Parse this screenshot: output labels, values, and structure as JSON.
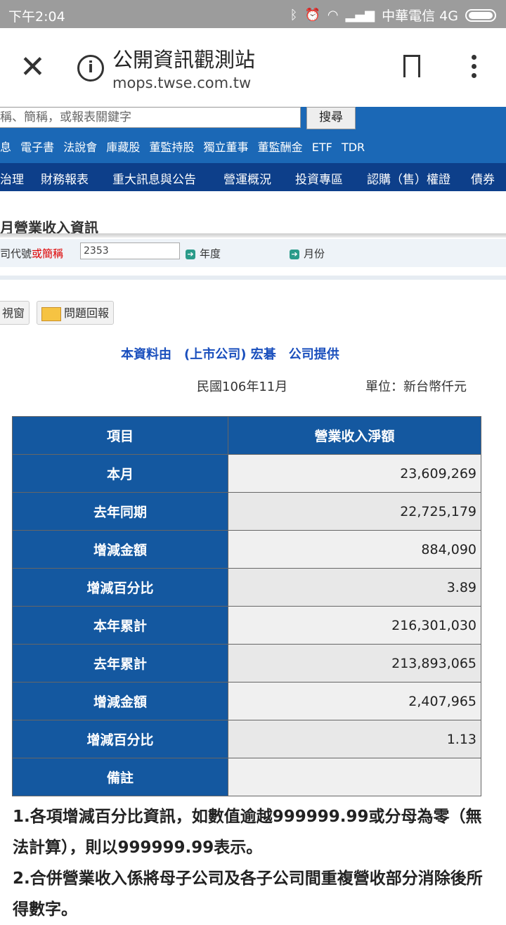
{
  "status_bar": {
    "time": "下午2:04",
    "carrier": "中華電信 4G"
  },
  "browser": {
    "page_title": "公開資訊觀測站",
    "url": "mops.twse.com.tw"
  },
  "search": {
    "placeholder": "稱、簡稱，或報表關鍵字",
    "button": "搜尋"
  },
  "quick_links": [
    "息",
    "電子書",
    "法說會",
    "庫藏股",
    "董監持股",
    "獨立董事",
    "董監酬金",
    "ETF",
    "TDR"
  ],
  "nav": [
    "治理",
    "財務報表",
    "重大訊息與公告",
    "營運概況",
    "投資專區",
    "認購（售）權證",
    "債券"
  ],
  "section": {
    "title": "月營業收入資訊",
    "code_label_prefix": "司代號",
    "code_label_red": "或簡稱",
    "code_value": "2353",
    "year_label": "年度",
    "month_label": "月份"
  },
  "toolbar": {
    "new_window": "視窗",
    "report": "問題回報"
  },
  "provider": {
    "text": "本資料由　(上市公司) 宏碁　公司提供"
  },
  "period": "民國106年11月",
  "unit": "單位：新台幣仟元",
  "table": {
    "headers": [
      "項目",
      "營業收入淨額"
    ],
    "rows": [
      {
        "item": "本月",
        "value": "23,609,269"
      },
      {
        "item": "去年同期",
        "value": "22,725,179"
      },
      {
        "item": "增減金額",
        "value": "884,090"
      },
      {
        "item": "增減百分比",
        "value": "3.89"
      },
      {
        "item": "本年累計",
        "value": "216,301,030"
      },
      {
        "item": "去年累計",
        "value": "213,893,065"
      },
      {
        "item": "增減金額",
        "value": "2,407,965"
      },
      {
        "item": "增減百分比",
        "value": "1.13"
      },
      {
        "item": "備註",
        "value": ""
      }
    ]
  },
  "notes": [
    "1.各項增減百分比資訊，如數值逾越999999.99或分母為零（無法計算），則以999999.99表示。",
    "2.合併營業收入係將母子公司及各子公司間重複營收部分消除後所得數字。"
  ]
}
